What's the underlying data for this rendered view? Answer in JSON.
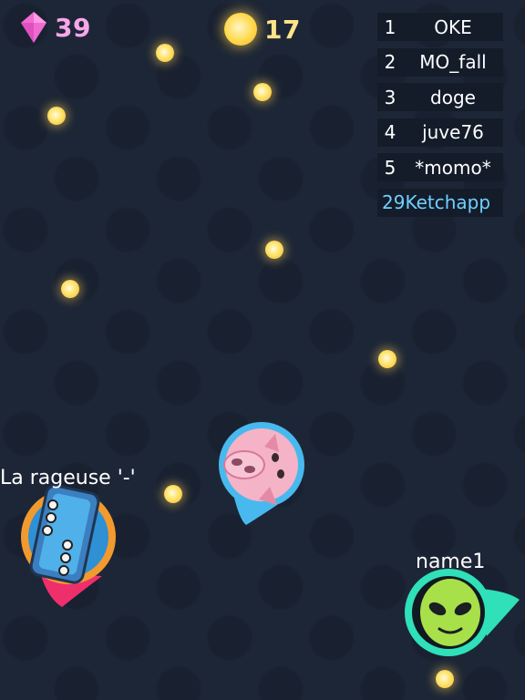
{
  "hud": {
    "gems": "39",
    "coins": "17",
    "gem_icon": "pink-diamond-icon",
    "coin_icon": "gold-coin-icon"
  },
  "leaderboard": [
    {
      "rank": "1",
      "name": "OKE"
    },
    {
      "rank": "2",
      "name": "MO_fall"
    },
    {
      "rank": "3",
      "name": "doge"
    },
    {
      "rank": "4",
      "name": "juve76"
    },
    {
      "rank": "5",
      "name": "*momo*"
    }
  ],
  "my_rank": {
    "rank": "29",
    "name": "Ketchapp"
  },
  "players": {
    "pig": {
      "name": "",
      "skin": "pig-face",
      "ring_color": "#3fb4e6"
    },
    "train": {
      "name": "La rageuse '-'",
      "skin": "blue-train",
      "ring_color": "#f29a2e"
    },
    "alien": {
      "name": "name1",
      "skin": "green-alien",
      "ring_color": "#2fe0b8"
    }
  },
  "colors": {
    "background": "#1d2636",
    "leaderboard_self": "#6fd0ff",
    "gem_text": "#f7a6ea",
    "coin_text": "#ffe38a"
  }
}
